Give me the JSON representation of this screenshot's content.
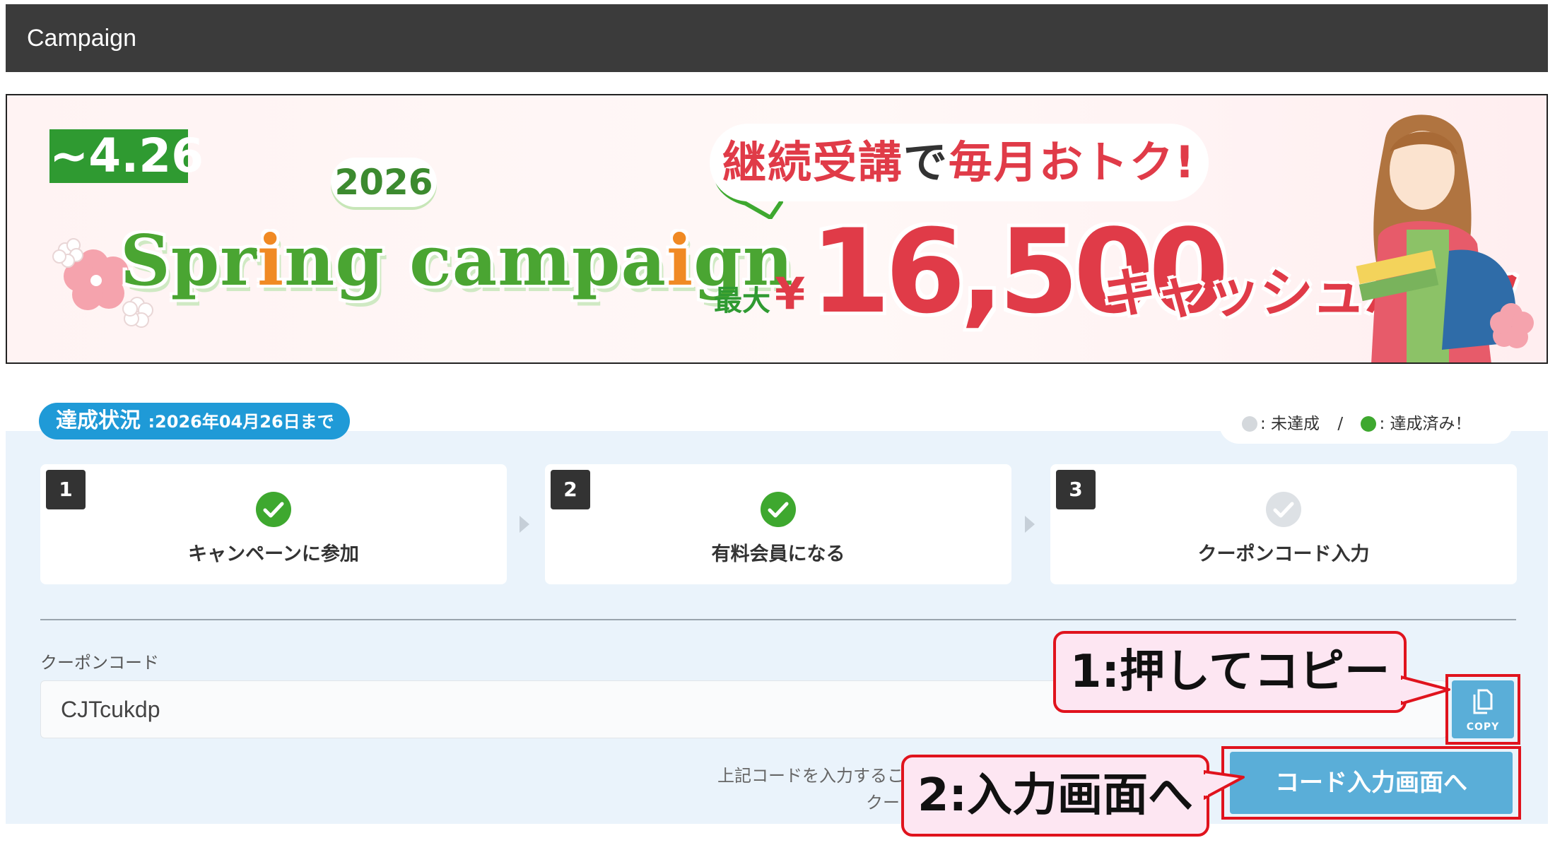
{
  "header": {
    "title": "Campaign"
  },
  "banner": {
    "date_badge": "~4.26",
    "year": "2026",
    "title_parts": [
      "Spr",
      "i",
      "ng campa",
      "i",
      "gn"
    ],
    "speech_red": "継続受講",
    "speech_dark": "で",
    "speech_red2": "毎月おトク!",
    "max_label": "最大",
    "yen": "¥",
    "amount": "16,500",
    "cashback": "キャッシュバック"
  },
  "status": {
    "pill_title": "達成状況",
    "pill_date": ":2026年04月26日まで",
    "legend_pending": ": 未達成",
    "legend_separator": "/",
    "legend_done": ": 達成済み！",
    "steps": [
      {
        "number": "1",
        "label": "キャンペーンに参加",
        "done": true
      },
      {
        "number": "2",
        "label": "有料会員になる",
        "done": true
      },
      {
        "number": "3",
        "label": "クーポンコード入力",
        "done": false
      }
    ]
  },
  "coupon": {
    "label": "クーポンコード",
    "code": "CJTcukdp",
    "copy_label": "COPY",
    "note_line1": "上記コードを入力するこ",
    "note_line2": "クー",
    "entry_button": "コード入力画面へ"
  },
  "callouts": {
    "copy": "1:押してコピー",
    "entry": "2:入力画面へ"
  },
  "colors": {
    "header_bg": "#3b3b3b",
    "accent_blue": "#1f9ad7",
    "button_blue": "#5aaed8",
    "check_green": "#3ea82f",
    "pending_gray": "#d4d8dc",
    "highlight_red": "#e0131d",
    "banner_red": "#e03b48"
  }
}
